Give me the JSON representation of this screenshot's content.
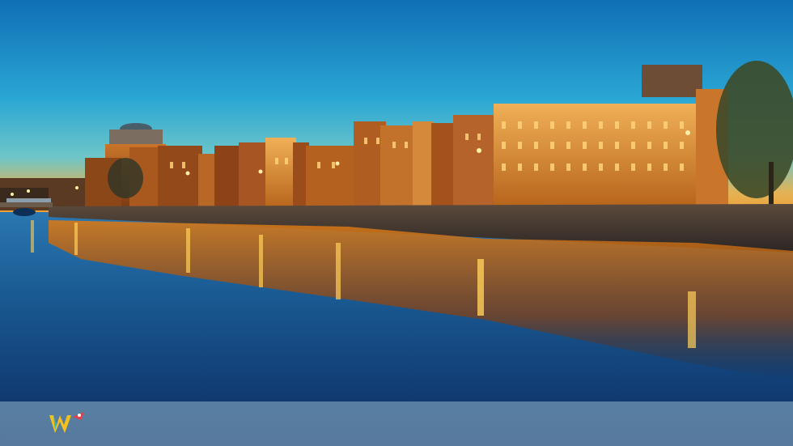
{
  "image": {
    "subject": "city-riverfront-at-dusk",
    "colors": {
      "sky_top": "#1a86c9",
      "sky_mid": "#3fb1d6",
      "sky_horizon": "#f2a93b",
      "water_top": "#1d5f95",
      "water_bottom": "#0d2f63",
      "lights": "#ffb020",
      "footer": "#9dbfd1"
    }
  },
  "footer": {
    "logo_icon": "w-letter-rocket-logo-icon"
  }
}
